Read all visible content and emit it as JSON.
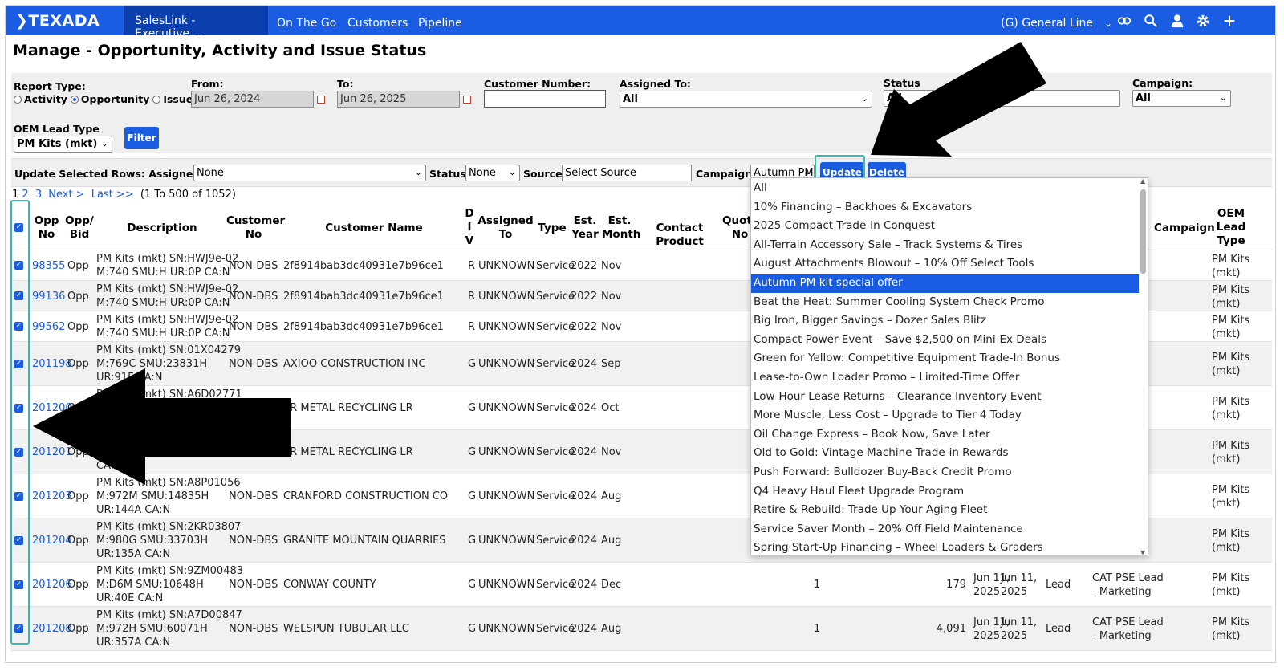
{
  "nav": {
    "logo": "TEXADA",
    "app": "SalesLink - Executive",
    "links": [
      "On The Go",
      "Customers",
      "Pipeline"
    ],
    "division": "(G) General Line"
  },
  "page_title": "Manage - Opportunity, Activity and Issue Status",
  "filters": {
    "report_type_label": "Report Type:",
    "report_types": [
      "Activity",
      "Opportunity",
      "Issue"
    ],
    "report_type_selected": "Opportunity",
    "from_label": "From:",
    "from_value": "Jun 26, 2024",
    "to_label": "To:",
    "to_value": "Jun 26, 2025",
    "customer_number_label": "Customer Number:",
    "customer_number_value": "",
    "assigned_to_label": "Assigned To:",
    "assigned_to_value": "All",
    "status_label": "Status",
    "status_value": "All",
    "campaign_label": "Campaign:",
    "campaign_value": "All",
    "oem_lead_type_label": "OEM Lead Type",
    "oem_lead_type_value": "PM Kits (mkt)",
    "filter_button": "Filter"
  },
  "bulk_update": {
    "label": "Update Selected Rows: Assigned To:",
    "assigned_to_value": "None",
    "status_label": "Status:",
    "status_value": "None",
    "source_label": "Source:",
    "source_value": "Select Source",
    "campaign_label": "Campaign:",
    "campaign_value": "Autumn PM",
    "update_button": "Update",
    "delete_button": "Delete"
  },
  "pager": {
    "pages": [
      "1",
      "2",
      "3"
    ],
    "next": "Next >",
    "last": "Last >>",
    "summary": "(1 To 500 of 1052)"
  },
  "table": {
    "headers": {
      "opp_no": [
        "Opp",
        "No"
      ],
      "opp_bid": [
        "Opp/",
        "Bid"
      ],
      "description": "Description",
      "customer_no": [
        "Customer",
        "No"
      ],
      "customer_name": "Customer Name",
      "div": [
        "D",
        "I",
        "V"
      ],
      "assigned_to": [
        "Assigned",
        "To"
      ],
      "type": "Type",
      "est_year": [
        "Est.",
        "Year"
      ],
      "est_month": [
        "Est.",
        "Month"
      ],
      "contact_product": "Contact Product",
      "quote_no": [
        "Quote",
        "No"
      ],
      "campaign": "Campaign",
      "oem_lead_type": [
        "OEM",
        "Lead",
        "Type"
      ]
    },
    "rows": [
      {
        "checked": true,
        "opp_no": "98355",
        "bid": "Opp",
        "desc": [
          "PM Kits (mkt) SN:HWJ9e-02",
          "M:740 SMU:H UR:0P CA:N"
        ],
        "cust_no": "NON-DBS",
        "cust_name": "2f8914bab3dc40931e7b96ce1",
        "div": "R",
        "assigned": "UNKNOWN",
        "type": "Service",
        "year": "2022",
        "month": "Nov",
        "oem": [
          "PM Kits",
          "(mkt)"
        ]
      },
      {
        "checked": true,
        "opp_no": "99136",
        "bid": "Opp",
        "desc": [
          "PM Kits (mkt) SN:HWJ9e-02",
          "M:740 SMU:H UR:0P CA:N"
        ],
        "cust_no": "NON-DBS",
        "cust_name": "2f8914bab3dc40931e7b96ce1",
        "div": "R",
        "assigned": "UNKNOWN",
        "type": "Service",
        "year": "2022",
        "month": "Nov",
        "oem": [
          "PM Kits",
          "(mkt)"
        ]
      },
      {
        "checked": true,
        "opp_no": "99562",
        "bid": "Opp",
        "desc": [
          "PM Kits (mkt) SN:HWJ9e-02",
          "M:740 SMU:H UR:0P CA:N"
        ],
        "cust_no": "NON-DBS",
        "cust_name": "2f8914bab3dc40931e7b96ce1",
        "div": "R",
        "assigned": "UNKNOWN",
        "type": "Service",
        "year": "2022",
        "month": "Nov",
        "oem": [
          "PM Kits",
          "(mkt)"
        ]
      },
      {
        "checked": true,
        "opp_no": "201198",
        "bid": "Opp",
        "desc": [
          "PM Kits (mkt) SN:01X04279",
          "M:769C SMU:23831H",
          "UR:91F CA:N"
        ],
        "cust_no": "NON-DBS",
        "cust_name": "AXIOO CONSTRUCTION INC",
        "div": "G",
        "assigned": "UNKNOWN",
        "type": "Service",
        "year": "2024",
        "month": "Sep",
        "oem": [
          "PM Kits",
          "(mkt)"
        ]
      },
      {
        "checked": true,
        "opp_no": "201200",
        "bid": "Opp",
        "desc": [
          "PM Kits (mkt) SN:A6D02771",
          "",
          ""
        ],
        "cust_no": "NON-DBS",
        "cust_name": "ER METAL RECYCLING LR",
        "div": "G",
        "assigned": "UNKNOWN",
        "type": "Service",
        "year": "2024",
        "month": "Oct",
        "oem": [
          "PM Kits",
          "(mkt)"
        ]
      },
      {
        "checked": true,
        "opp_no": "201201",
        "bid": "Opp",
        "desc": [
          "",
          "",
          "CA:N"
        ],
        "cust_no": "NON-DBS",
        "cust_name": "ER METAL RECYCLING LR",
        "div": "G",
        "assigned": "UNKNOWN",
        "type": "Service",
        "year": "2024",
        "month": "Nov",
        "oem": [
          "PM Kits",
          "(mkt)"
        ]
      },
      {
        "checked": true,
        "opp_no": "201203",
        "bid": "Opp",
        "desc": [
          "PM Kits (mkt) SN:A8P01056",
          "M:972M SMU:14835H",
          "UR:144A CA:N"
        ],
        "cust_no": "NON-DBS",
        "cust_name": "CRANFORD CONSTRUCTION CO",
        "div": "G",
        "assigned": "UNKNOWN",
        "type": "Service",
        "year": "2024",
        "month": "Aug",
        "oem": [
          "PM Kits",
          "(mkt)"
        ]
      },
      {
        "checked": true,
        "opp_no": "201204",
        "bid": "Opp",
        "desc": [
          "PM Kits (mkt) SN:2KR03807",
          "M:980G SMU:33703H",
          "UR:135A CA:N"
        ],
        "cust_no": "NON-DBS",
        "cust_name": "GRANITE MOUNTAIN QUARRIES",
        "div": "G",
        "assigned": "UNKNOWN",
        "type": "Service",
        "year": "2024",
        "month": "Aug",
        "oem": [
          "PM Kits",
          "(mkt)"
        ]
      },
      {
        "checked": true,
        "opp_no": "201206",
        "bid": "Opp",
        "desc": [
          "PM Kits (mkt) SN:9ZM00483",
          "M:D6M SMU:10648H",
          "UR:40E CA:N"
        ],
        "cust_no": "NON-DBS",
        "cust_name": "CONWAY COUNTY",
        "div": "G",
        "assigned": "UNKNOWN",
        "type": "Service",
        "year": "2024",
        "month": "Dec",
        "qty": "1",
        "value": "179",
        "date1": [
          "Jun 11,",
          "2025"
        ],
        "date2": [
          "Jun 11,",
          "2025"
        ],
        "stage": "Lead",
        "campaign": [
          "CAT PSE Lead",
          "- Marketing"
        ],
        "oem": [
          "PM Kits",
          "(mkt)"
        ]
      },
      {
        "checked": true,
        "opp_no": "201208",
        "bid": "Opp",
        "desc": [
          "PM Kits (mkt) SN:A7D00847",
          "M:972H SMU:60071H",
          "UR:357A CA:N"
        ],
        "cust_no": "NON-DBS",
        "cust_name": "WELSPUN TUBULAR LLC",
        "div": "G",
        "assigned": "UNKNOWN",
        "type": "Service",
        "year": "2024",
        "month": "Aug",
        "qty": "1",
        "value": "4,091",
        "date1": [
          "Jun 11,",
          "2025"
        ],
        "date2": [
          "Jun 11,",
          "2025"
        ],
        "stage": "Lead",
        "campaign": [
          "CAT PSE Lead",
          "- Marketing"
        ],
        "oem": [
          "PM Kits",
          "(mkt)"
        ]
      }
    ]
  },
  "campaign_dropdown": {
    "selected": "Autumn PM kit special offer",
    "options": [
      "All",
      "10% Financing – Backhoes & Excavators",
      "2025 Compact Trade-In Conquest",
      "All-Terrain Accessory Sale – Track Systems & Tires",
      "August Attachments Blowout – 10% Off Select Tools",
      "Autumn PM kit special offer",
      "Beat the Heat: Summer Cooling System Check Promo",
      "Big Iron, Bigger Savings – Dozer Sales Blitz",
      "Compact Power Event – Save $2,500 on Mini-Ex Deals",
      "Green for Yellow: Competitive Equipment Trade-In Bonus",
      "Lease-to-Own Loader Promo – Limited-Time Offer",
      "Low-Hour Lease Returns – Clearance Inventory Event",
      "More Muscle, Less Cost – Upgrade to Tier 4 Today",
      "Oil Change Express – Book Now, Save Later",
      "Old to Gold: Vintage Machine Trade-in Rewards",
      "Push Forward: Bulldozer Buy-Back Credit Promo",
      "Q4 Heavy Haul Fleet Upgrade Program",
      "Retire & Rebuild: Trade Up Your Aging Fleet",
      "Service Saver Month – 20% Off Field Maintenance",
      "Spring Start-Up Financing – Wheel Loaders & Graders"
    ]
  },
  "colors": {
    "nav_blue": "#1a5de3",
    "nav_dark": "#0b3fae",
    "highlight_teal": "#35b9b0"
  }
}
